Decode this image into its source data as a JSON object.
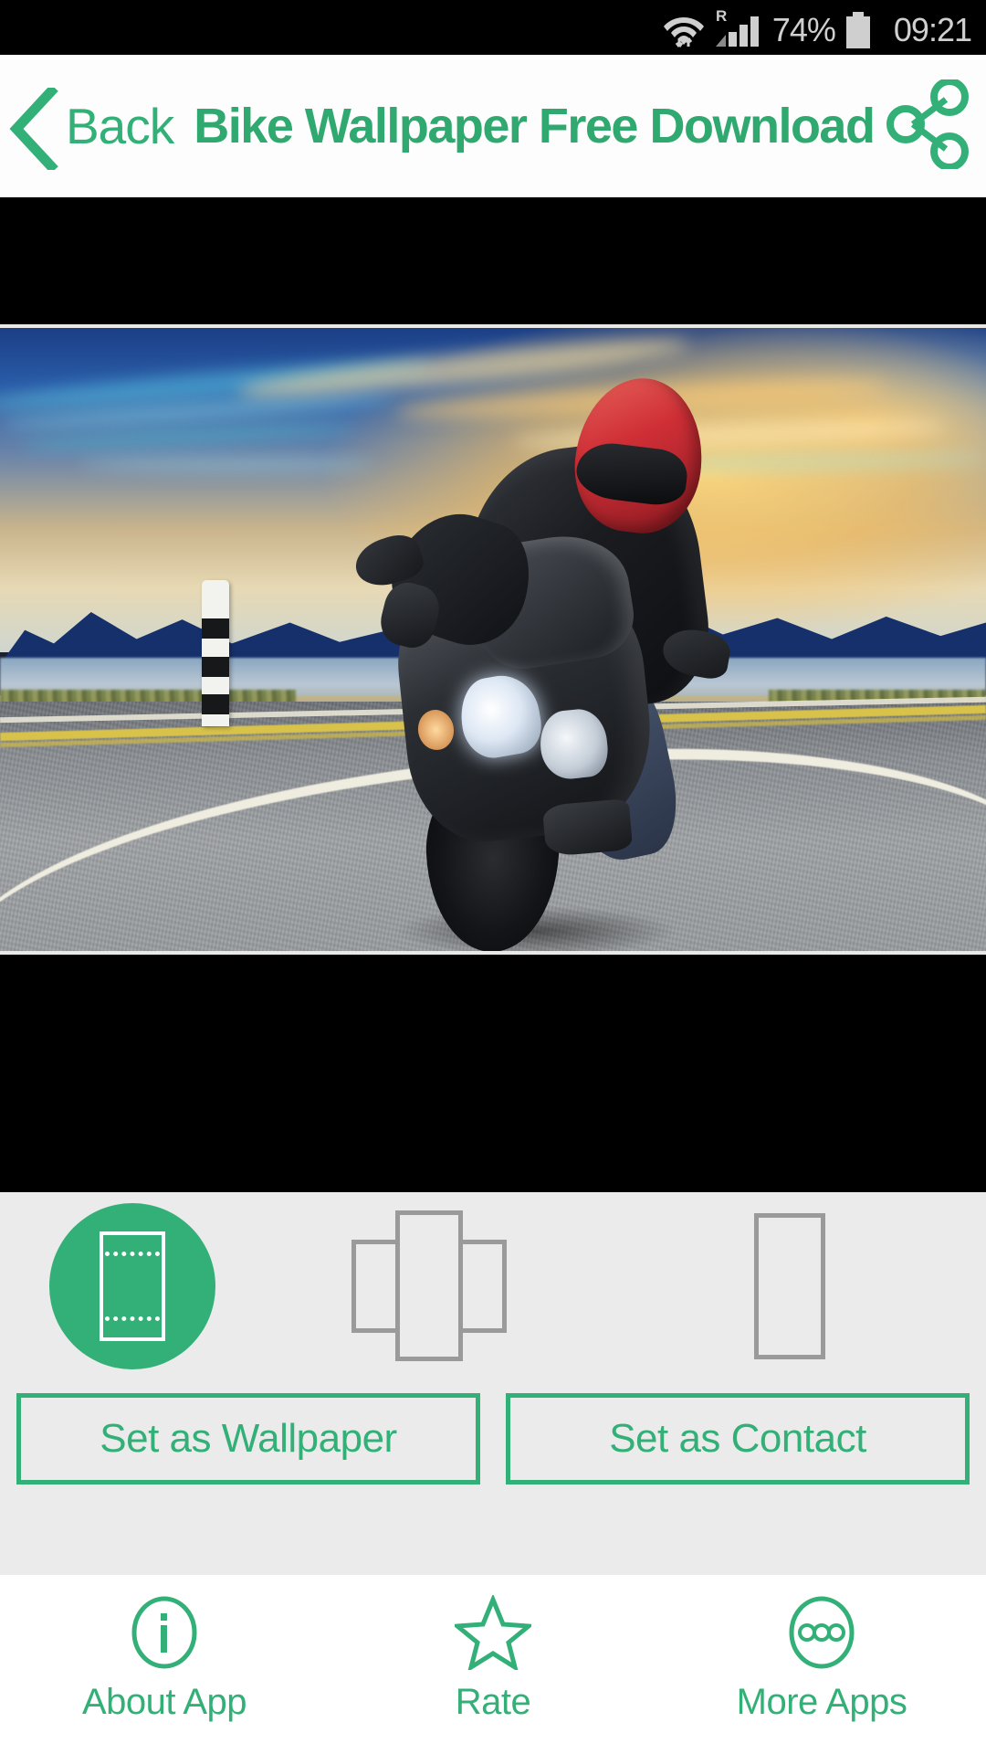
{
  "statusbar": {
    "wifi_icon": "wifi-icon",
    "data_transfer_icon": "data-transfer-arrows-icon",
    "roaming_label": "R",
    "signal_icon": "signal-bars-icon",
    "battery_percent": "74%",
    "battery_icon": "battery-icon",
    "time": "09:21"
  },
  "header": {
    "back_icon": "chevron-left-icon",
    "back_label": "Back",
    "title": "Bike Wallpaper Free Download",
    "share_icon": "share-icon"
  },
  "wallpaper": {
    "alt": "motorcycle-rider-wallpaper-preview"
  },
  "modes": [
    {
      "name": "home-screen",
      "icon": "home-screen-crop-icon",
      "selected": true
    },
    {
      "name": "scrollable",
      "icon": "scrollable-pages-icon",
      "selected": false
    },
    {
      "name": "lock-screen",
      "icon": "single-page-icon",
      "selected": false
    }
  ],
  "actions": {
    "set_wallpaper_label": "Set as Wallpaper",
    "set_contact_label": "Set as Contact"
  },
  "bottomnav": [
    {
      "icon": "info-circle-icon",
      "label": "About App"
    },
    {
      "icon": "star-outline-icon",
      "label": "Rate"
    },
    {
      "icon": "more-dots-circle-icon",
      "label": "More Apps"
    }
  ],
  "colors": {
    "accent_green": "#32b077",
    "panel_bg": "#ebebeb",
    "status_bg": "#000000",
    "icon_gray": "#9a9a9a"
  }
}
